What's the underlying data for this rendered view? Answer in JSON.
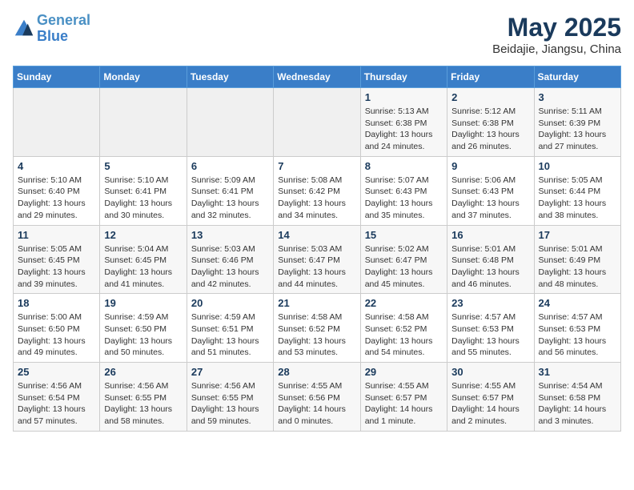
{
  "header": {
    "logo_line1": "General",
    "logo_line2": "Blue",
    "month": "May 2025",
    "location": "Beidajie, Jiangsu, China"
  },
  "weekdays": [
    "Sunday",
    "Monday",
    "Tuesday",
    "Wednesday",
    "Thursday",
    "Friday",
    "Saturday"
  ],
  "weeks": [
    [
      {
        "day": "",
        "info": ""
      },
      {
        "day": "",
        "info": ""
      },
      {
        "day": "",
        "info": ""
      },
      {
        "day": "",
        "info": ""
      },
      {
        "day": "1",
        "info": "Sunrise: 5:13 AM\nSunset: 6:38 PM\nDaylight: 13 hours\nand 24 minutes."
      },
      {
        "day": "2",
        "info": "Sunrise: 5:12 AM\nSunset: 6:38 PM\nDaylight: 13 hours\nand 26 minutes."
      },
      {
        "day": "3",
        "info": "Sunrise: 5:11 AM\nSunset: 6:39 PM\nDaylight: 13 hours\nand 27 minutes."
      }
    ],
    [
      {
        "day": "4",
        "info": "Sunrise: 5:10 AM\nSunset: 6:40 PM\nDaylight: 13 hours\nand 29 minutes."
      },
      {
        "day": "5",
        "info": "Sunrise: 5:10 AM\nSunset: 6:41 PM\nDaylight: 13 hours\nand 30 minutes."
      },
      {
        "day": "6",
        "info": "Sunrise: 5:09 AM\nSunset: 6:41 PM\nDaylight: 13 hours\nand 32 minutes."
      },
      {
        "day": "7",
        "info": "Sunrise: 5:08 AM\nSunset: 6:42 PM\nDaylight: 13 hours\nand 34 minutes."
      },
      {
        "day": "8",
        "info": "Sunrise: 5:07 AM\nSunset: 6:43 PM\nDaylight: 13 hours\nand 35 minutes."
      },
      {
        "day": "9",
        "info": "Sunrise: 5:06 AM\nSunset: 6:43 PM\nDaylight: 13 hours\nand 37 minutes."
      },
      {
        "day": "10",
        "info": "Sunrise: 5:05 AM\nSunset: 6:44 PM\nDaylight: 13 hours\nand 38 minutes."
      }
    ],
    [
      {
        "day": "11",
        "info": "Sunrise: 5:05 AM\nSunset: 6:45 PM\nDaylight: 13 hours\nand 39 minutes."
      },
      {
        "day": "12",
        "info": "Sunrise: 5:04 AM\nSunset: 6:45 PM\nDaylight: 13 hours\nand 41 minutes."
      },
      {
        "day": "13",
        "info": "Sunrise: 5:03 AM\nSunset: 6:46 PM\nDaylight: 13 hours\nand 42 minutes."
      },
      {
        "day": "14",
        "info": "Sunrise: 5:03 AM\nSunset: 6:47 PM\nDaylight: 13 hours\nand 44 minutes."
      },
      {
        "day": "15",
        "info": "Sunrise: 5:02 AM\nSunset: 6:47 PM\nDaylight: 13 hours\nand 45 minutes."
      },
      {
        "day": "16",
        "info": "Sunrise: 5:01 AM\nSunset: 6:48 PM\nDaylight: 13 hours\nand 46 minutes."
      },
      {
        "day": "17",
        "info": "Sunrise: 5:01 AM\nSunset: 6:49 PM\nDaylight: 13 hours\nand 48 minutes."
      }
    ],
    [
      {
        "day": "18",
        "info": "Sunrise: 5:00 AM\nSunset: 6:50 PM\nDaylight: 13 hours\nand 49 minutes."
      },
      {
        "day": "19",
        "info": "Sunrise: 4:59 AM\nSunset: 6:50 PM\nDaylight: 13 hours\nand 50 minutes."
      },
      {
        "day": "20",
        "info": "Sunrise: 4:59 AM\nSunset: 6:51 PM\nDaylight: 13 hours\nand 51 minutes."
      },
      {
        "day": "21",
        "info": "Sunrise: 4:58 AM\nSunset: 6:52 PM\nDaylight: 13 hours\nand 53 minutes."
      },
      {
        "day": "22",
        "info": "Sunrise: 4:58 AM\nSunset: 6:52 PM\nDaylight: 13 hours\nand 54 minutes."
      },
      {
        "day": "23",
        "info": "Sunrise: 4:57 AM\nSunset: 6:53 PM\nDaylight: 13 hours\nand 55 minutes."
      },
      {
        "day": "24",
        "info": "Sunrise: 4:57 AM\nSunset: 6:53 PM\nDaylight: 13 hours\nand 56 minutes."
      }
    ],
    [
      {
        "day": "25",
        "info": "Sunrise: 4:56 AM\nSunset: 6:54 PM\nDaylight: 13 hours\nand 57 minutes."
      },
      {
        "day": "26",
        "info": "Sunrise: 4:56 AM\nSunset: 6:55 PM\nDaylight: 13 hours\nand 58 minutes."
      },
      {
        "day": "27",
        "info": "Sunrise: 4:56 AM\nSunset: 6:55 PM\nDaylight: 13 hours\nand 59 minutes."
      },
      {
        "day": "28",
        "info": "Sunrise: 4:55 AM\nSunset: 6:56 PM\nDaylight: 14 hours\nand 0 minutes."
      },
      {
        "day": "29",
        "info": "Sunrise: 4:55 AM\nSunset: 6:57 PM\nDaylight: 14 hours\nand 1 minute."
      },
      {
        "day": "30",
        "info": "Sunrise: 4:55 AM\nSunset: 6:57 PM\nDaylight: 14 hours\nand 2 minutes."
      },
      {
        "day": "31",
        "info": "Sunrise: 4:54 AM\nSunset: 6:58 PM\nDaylight: 14 hours\nand 3 minutes."
      }
    ]
  ]
}
